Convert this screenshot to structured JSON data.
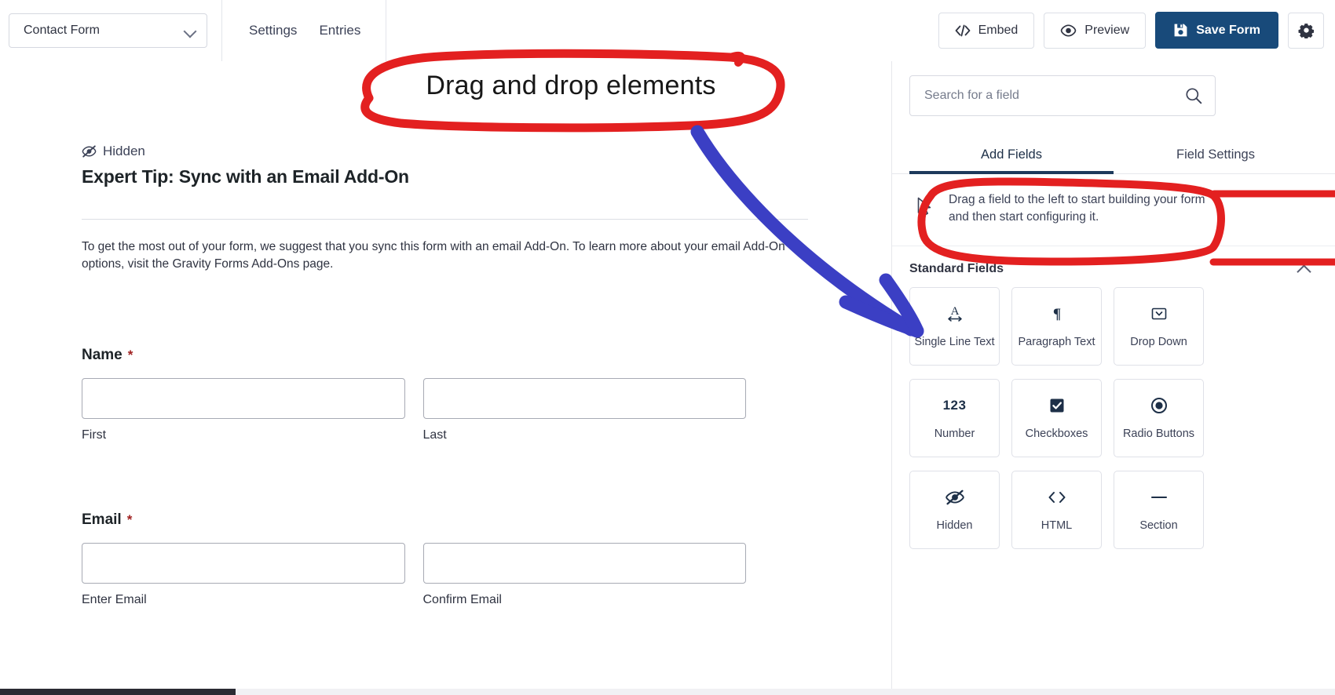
{
  "topbar": {
    "form_selector": {
      "value": "Contact Form",
      "icon": "chevron-down-icon"
    },
    "nav_tabs": [
      "Settings",
      "Entries"
    ],
    "buttons": [
      {
        "label": "Embed",
        "icon": "code-embed-icon"
      },
      {
        "label": "Preview",
        "icon": "eye-icon"
      },
      {
        "label": "Save Form",
        "icon": "floppy-disk-save-icon",
        "primary": true
      }
    ],
    "settings_icon": "gear-icon",
    "primary_color": "#184A7A"
  },
  "annotations": {
    "callout_label": "Drag and drop elements",
    "callout_color": "#E32020",
    "arrow_color": "#3B3FC4"
  },
  "canvas": {
    "hidden_tag": {
      "label": "Hidden",
      "icon": "eye-slash-icon"
    },
    "section_title": "Expert Tip: Sync with an Email Add-On",
    "section_description": "To get the most out of your form, we suggest that you sync this form with an email Add-On. To learn more about your email Add-On options, visit the Gravity Forms Add-Ons page.",
    "fields": [
      {
        "label": "Name",
        "required": "*",
        "sub_fields": [
          {
            "sub_label": "First",
            "value": ""
          },
          {
            "sub_label": "Last",
            "value": ""
          }
        ]
      },
      {
        "label": "Email",
        "required": "*",
        "sub_fields": [
          {
            "sub_label": "Enter Email",
            "value": ""
          },
          {
            "sub_label": "Confirm Email",
            "value": ""
          }
        ]
      }
    ]
  },
  "sidebar": {
    "search": {
      "placeholder": "Search for a field",
      "value": "",
      "icon": "search-icon"
    },
    "tabs": [
      {
        "label": "Add Fields",
        "active": true
      },
      {
        "label": "Field Settings",
        "active": false
      }
    ],
    "hint": {
      "text": "Drag a field to the left to start building your form and then start configuring it.",
      "icon": "cursor-pointer-icon"
    },
    "groups": [
      {
        "title": "Standard Fields",
        "collapse_icon": "chevron-up-icon",
        "cards": [
          {
            "label": "Single Line Text",
            "icon": "single-line-text-icon"
          },
          {
            "label": "Paragraph Text",
            "icon": "pilcrow-icon"
          },
          {
            "label": "Drop Down",
            "icon": "dropdown-icon"
          },
          {
            "label": "Number",
            "icon": "123-icon"
          },
          {
            "label": "Checkboxes",
            "icon": "checkbox-icon"
          },
          {
            "label": "Radio Buttons",
            "icon": "radio-button-icon"
          },
          {
            "label": "Hidden",
            "icon": "eye-slash-icon"
          },
          {
            "label": "HTML",
            "icon": "code-brackets-icon"
          },
          {
            "label": "Section",
            "icon": "minus-line-icon"
          }
        ]
      }
    ]
  }
}
